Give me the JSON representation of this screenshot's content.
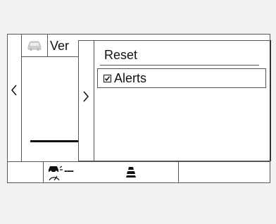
{
  "background_panel": {
    "title": "Ver",
    "icon": "car-icon",
    "nav_icon": "chevron-left-icon"
  },
  "menu": {
    "title": "Reset",
    "nav_icon": "chevron-right-icon",
    "items": [
      {
        "label": "Alerts",
        "checked": true
      }
    ]
  },
  "status_bar": {
    "speed_value": "---",
    "icons": [
      "adaptive-cruise-icon",
      "lane-assist-icon"
    ]
  },
  "colors": {
    "background": "#f2f2f2",
    "panel": "#ffffff",
    "border": "#555555",
    "text": "#111111"
  }
}
